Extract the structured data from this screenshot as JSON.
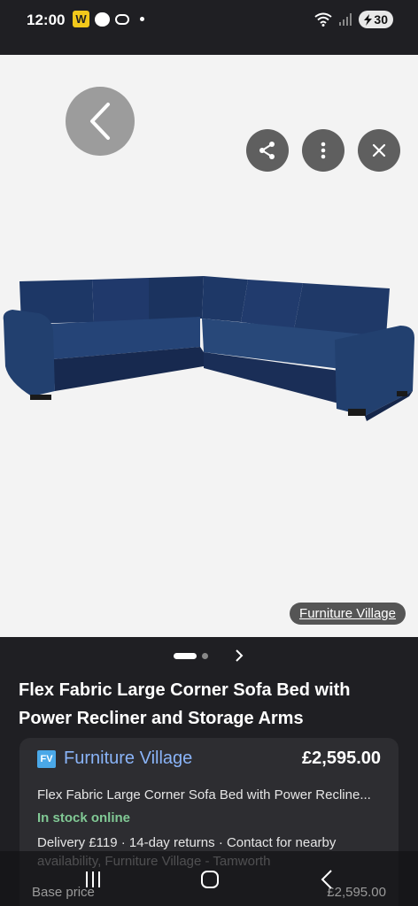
{
  "status_bar": {
    "time": "12:00",
    "notification_w": "W",
    "battery": "30"
  },
  "viewer": {
    "source_label": "Furniture Village"
  },
  "details": {
    "title": "Flex Fabric Large Corner Sofa Bed with Power Recliner and Storage Arms",
    "offer": {
      "logo": "FV",
      "store": "Furniture Village",
      "price": "£2,595.00",
      "description": "Flex Fabric Large Corner Sofa Bed with Power Recline...",
      "stock": "In stock online",
      "delivery": "Delivery £119 · 14-day returns · Contact for nearby availability, Furniture Village - Tamworth"
    },
    "base_price_label": "Base price",
    "base_price_value": "£2,595.00"
  },
  "colors": {
    "sofa": "#1d3766",
    "link": "#8ab4f8",
    "in_stock": "#81c995"
  }
}
